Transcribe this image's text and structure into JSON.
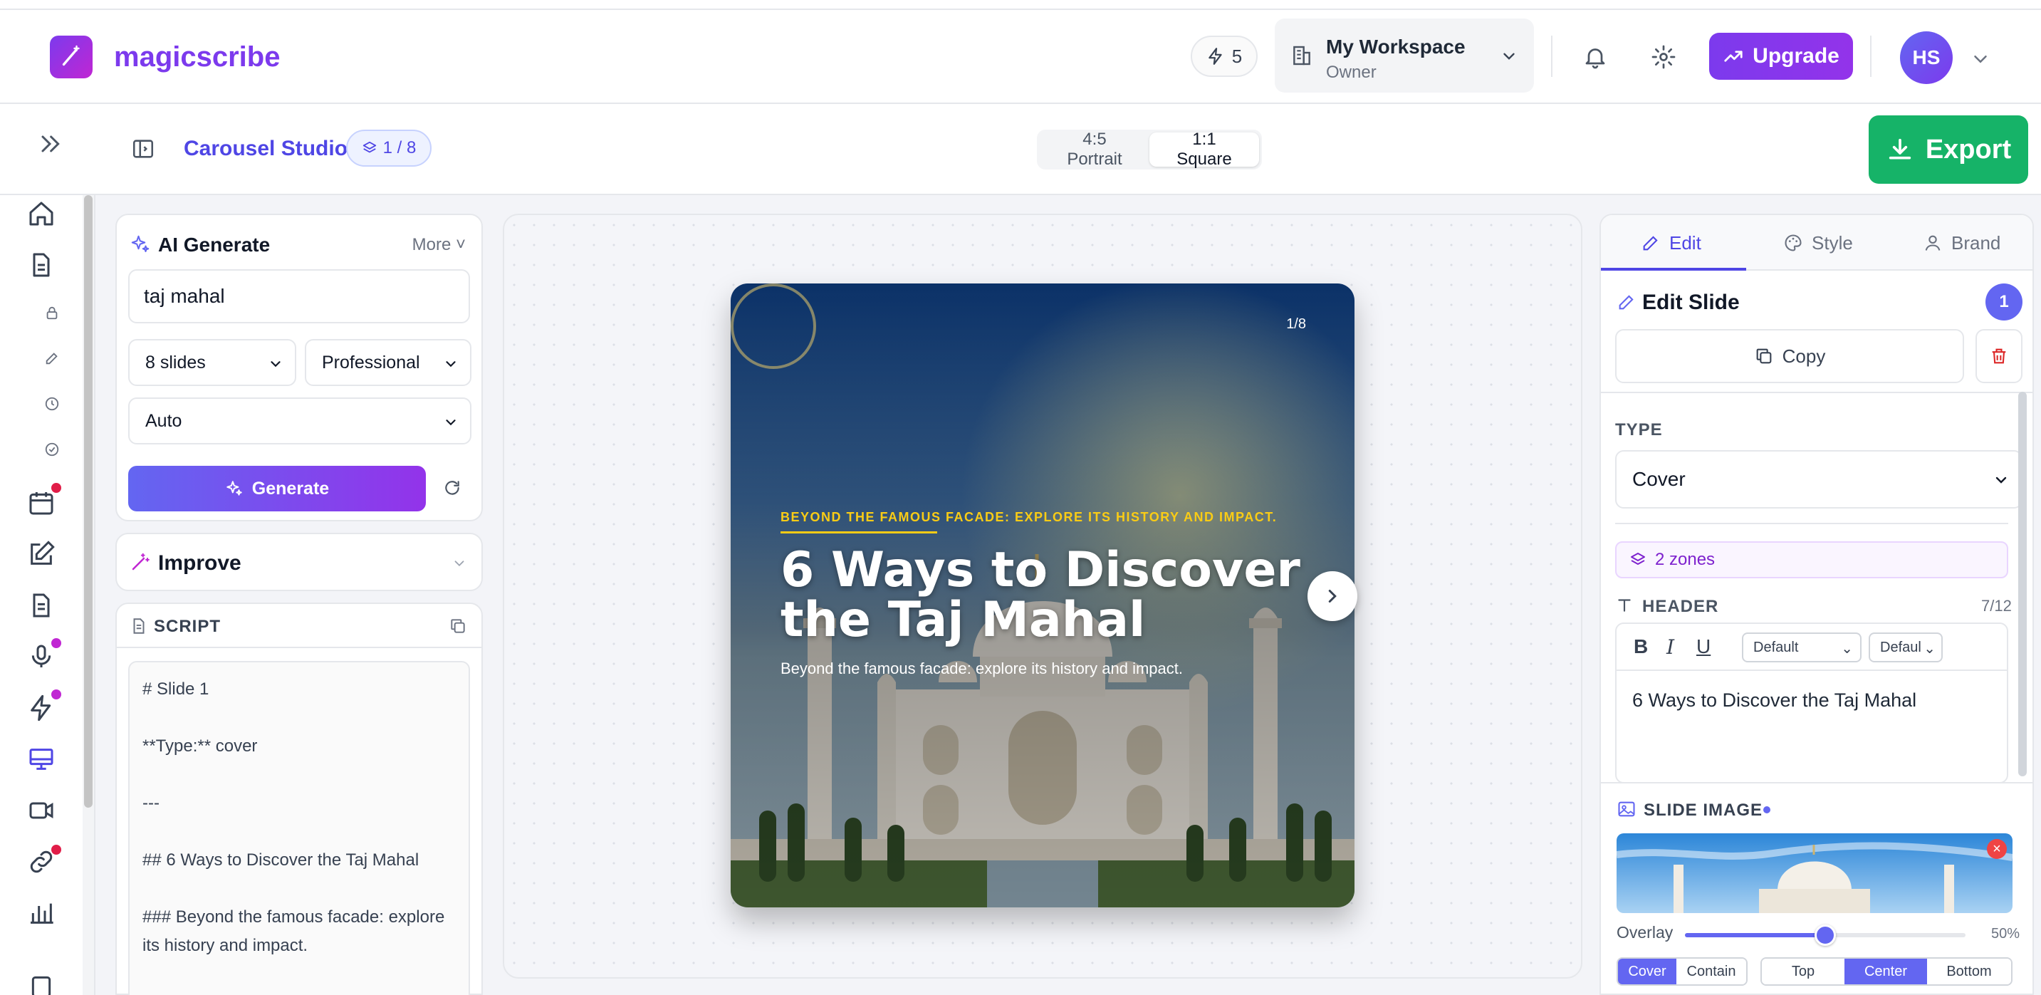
{
  "app": {
    "brand": "magicscribe",
    "credits": "5",
    "workspace": {
      "name": "My Workspace",
      "role": "Owner"
    },
    "upgrade_label": "Upgrade",
    "avatar_initials": "HS",
    "colors": {
      "brand": "#7c3aed",
      "accent": "#6366f1",
      "export": "#16b368"
    }
  },
  "toolbar": {
    "studio_title": "Carousel Studio",
    "slide_badge": "1 / 8",
    "ratios": [
      {
        "label": "4:5 Portrait",
        "active": false
      },
      {
        "label": "1:1 Square",
        "active": true
      }
    ],
    "export_label": "Export"
  },
  "leftnav": {
    "items": [
      "home-icon",
      "document-icon",
      "lock-icon",
      "edit-small-icon",
      "clock-icon",
      "check-circle-icon",
      "calendar-icon",
      "pen-square-icon",
      "file-text-icon",
      "microphone-icon",
      "bolt-icon",
      "monitor-icon",
      "video-icon",
      "link-icon",
      "bar-chart-icon"
    ]
  },
  "ai_generate": {
    "title": "AI Generate",
    "more_label": "More",
    "topic_value": "taj mahal",
    "slides_select": "8 slides",
    "tone_select": "Professional",
    "style_select": "Auto",
    "generate_label": "Generate"
  },
  "improve": {
    "title": "Improve"
  },
  "script": {
    "title": "SCRIPT",
    "lines": [
      "# Slide 1",
      "",
      "**Type:** cover",
      "",
      "---",
      "",
      "## 6 Ways to Discover the Taj Mahal",
      "",
      "### Beyond the famous facade: explore its history and impact.",
      ""
    ]
  },
  "slide": {
    "counter": "1/8",
    "kicker": "BEYOND THE FAMOUS FACADE: EXPLORE ITS HISTORY AND IMPACT.",
    "title": "6 Ways to Discover the Taj Mahal",
    "subtitle": "Beyond the famous facade: explore its history and impact."
  },
  "right_panel": {
    "tabs": [
      "Edit",
      "Style",
      "Brand"
    ],
    "edit_title": "Edit Slide",
    "slide_number": "1",
    "copy_label": "Copy",
    "type_label": "TYPE",
    "type_value": "Cover",
    "zones_label": "2 zones",
    "header_label": "HEADER",
    "header_count": "7/12",
    "font_select": "Default",
    "size_select": "Default",
    "header_text": "6 Ways to Discover the Taj Mahal",
    "slide_image_label": "SLIDE IMAGE",
    "overlay_label": "Overlay",
    "overlay_value": 50,
    "overlay_pct": "50%",
    "fit_options": [
      {
        "label": "Cover",
        "active": true
      },
      {
        "label": "Contain",
        "active": false
      }
    ],
    "position_options": [
      {
        "label": "Top",
        "active": false
      },
      {
        "label": "Center",
        "active": true
      },
      {
        "label": "Bottom",
        "active": false
      }
    ]
  }
}
